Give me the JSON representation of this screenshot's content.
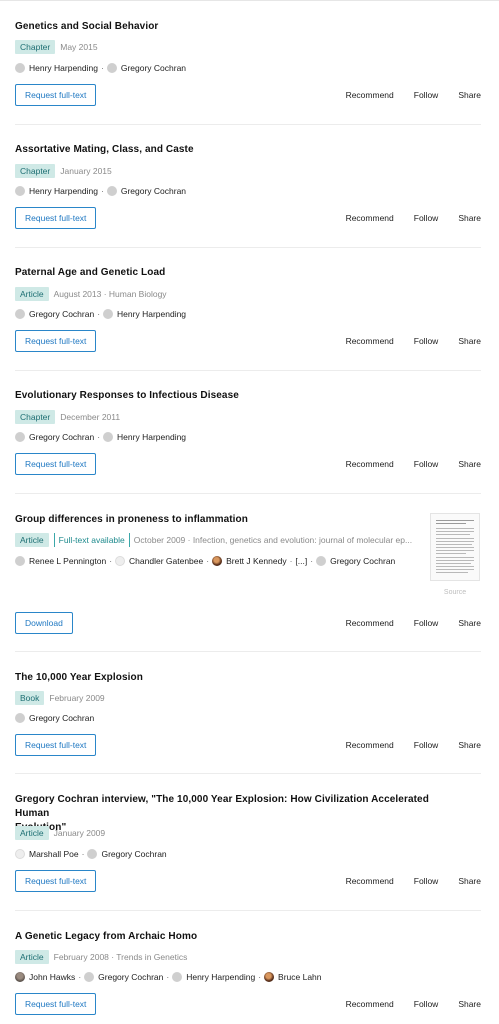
{
  "items": [
    {
      "title": "Genetics and Social Behavior",
      "type": "Chapter",
      "date": "May 2015",
      "authors": [
        "Henry Harpending",
        "Gregory Cochran"
      ],
      "button": "Request full-text"
    },
    {
      "title": "Assortative Mating, Class, and Caste",
      "type": "Chapter",
      "date": "January 2015",
      "authors": [
        "Henry Harpending",
        "Gregory Cochran"
      ],
      "button": "Request full-text"
    },
    {
      "title": "Paternal Age and Genetic Load",
      "type": "Article",
      "date": "August 2013 · Human Biology",
      "authors": [
        "Gregory Cochran",
        "Henry Harpending"
      ],
      "button": "Request full-text"
    },
    {
      "title": "Evolutionary Responses to Infectious Disease",
      "type": "Chapter",
      "date": "December 2011",
      "authors": [
        "Gregory Cochran",
        "Henry Harpending"
      ],
      "button": "Request full-text"
    },
    {
      "title": "Group differences in proneness to inflammation",
      "type": "Article",
      "fulltext_badge": "Full-text available",
      "date": "October 2009 · Infection, genetics and evolution: journal of molecular ep...",
      "authors": [
        "Renee L Pennington",
        "Chandler Gatenbee",
        "Brett J Kennedy",
        "[...]",
        "Gregory Cochran"
      ],
      "thumb_label": "Source",
      "button": "Download"
    },
    {
      "title": "The 10,000 Year Explosion",
      "type": "Book",
      "date": "February 2009",
      "authors": [
        "Gregory Cochran"
      ],
      "button": "Request full-text"
    },
    {
      "title_line1": "Gregory Cochran interview, \"The 10,000 Year Explosion: How Civilization Accelerated Human",
      "title_line2": "Evolution\"",
      "type": "Article",
      "date": "January 2009",
      "authors": [
        "Marshall Poe",
        "Gregory Cochran"
      ],
      "button": "Request full-text"
    },
    {
      "title": "A Genetic Legacy from Archaic Homo",
      "type": "Article",
      "date": "February 2008 · Trends in Genetics",
      "authors": [
        "John Hawks",
        "Gregory Cochran",
        "Henry Harpending",
        "Bruce Lahn"
      ],
      "button": "Request full-text"
    }
  ],
  "actions": {
    "recommend": "Recommend",
    "follow": "Follow",
    "share": "Share"
  },
  "separator": "·"
}
